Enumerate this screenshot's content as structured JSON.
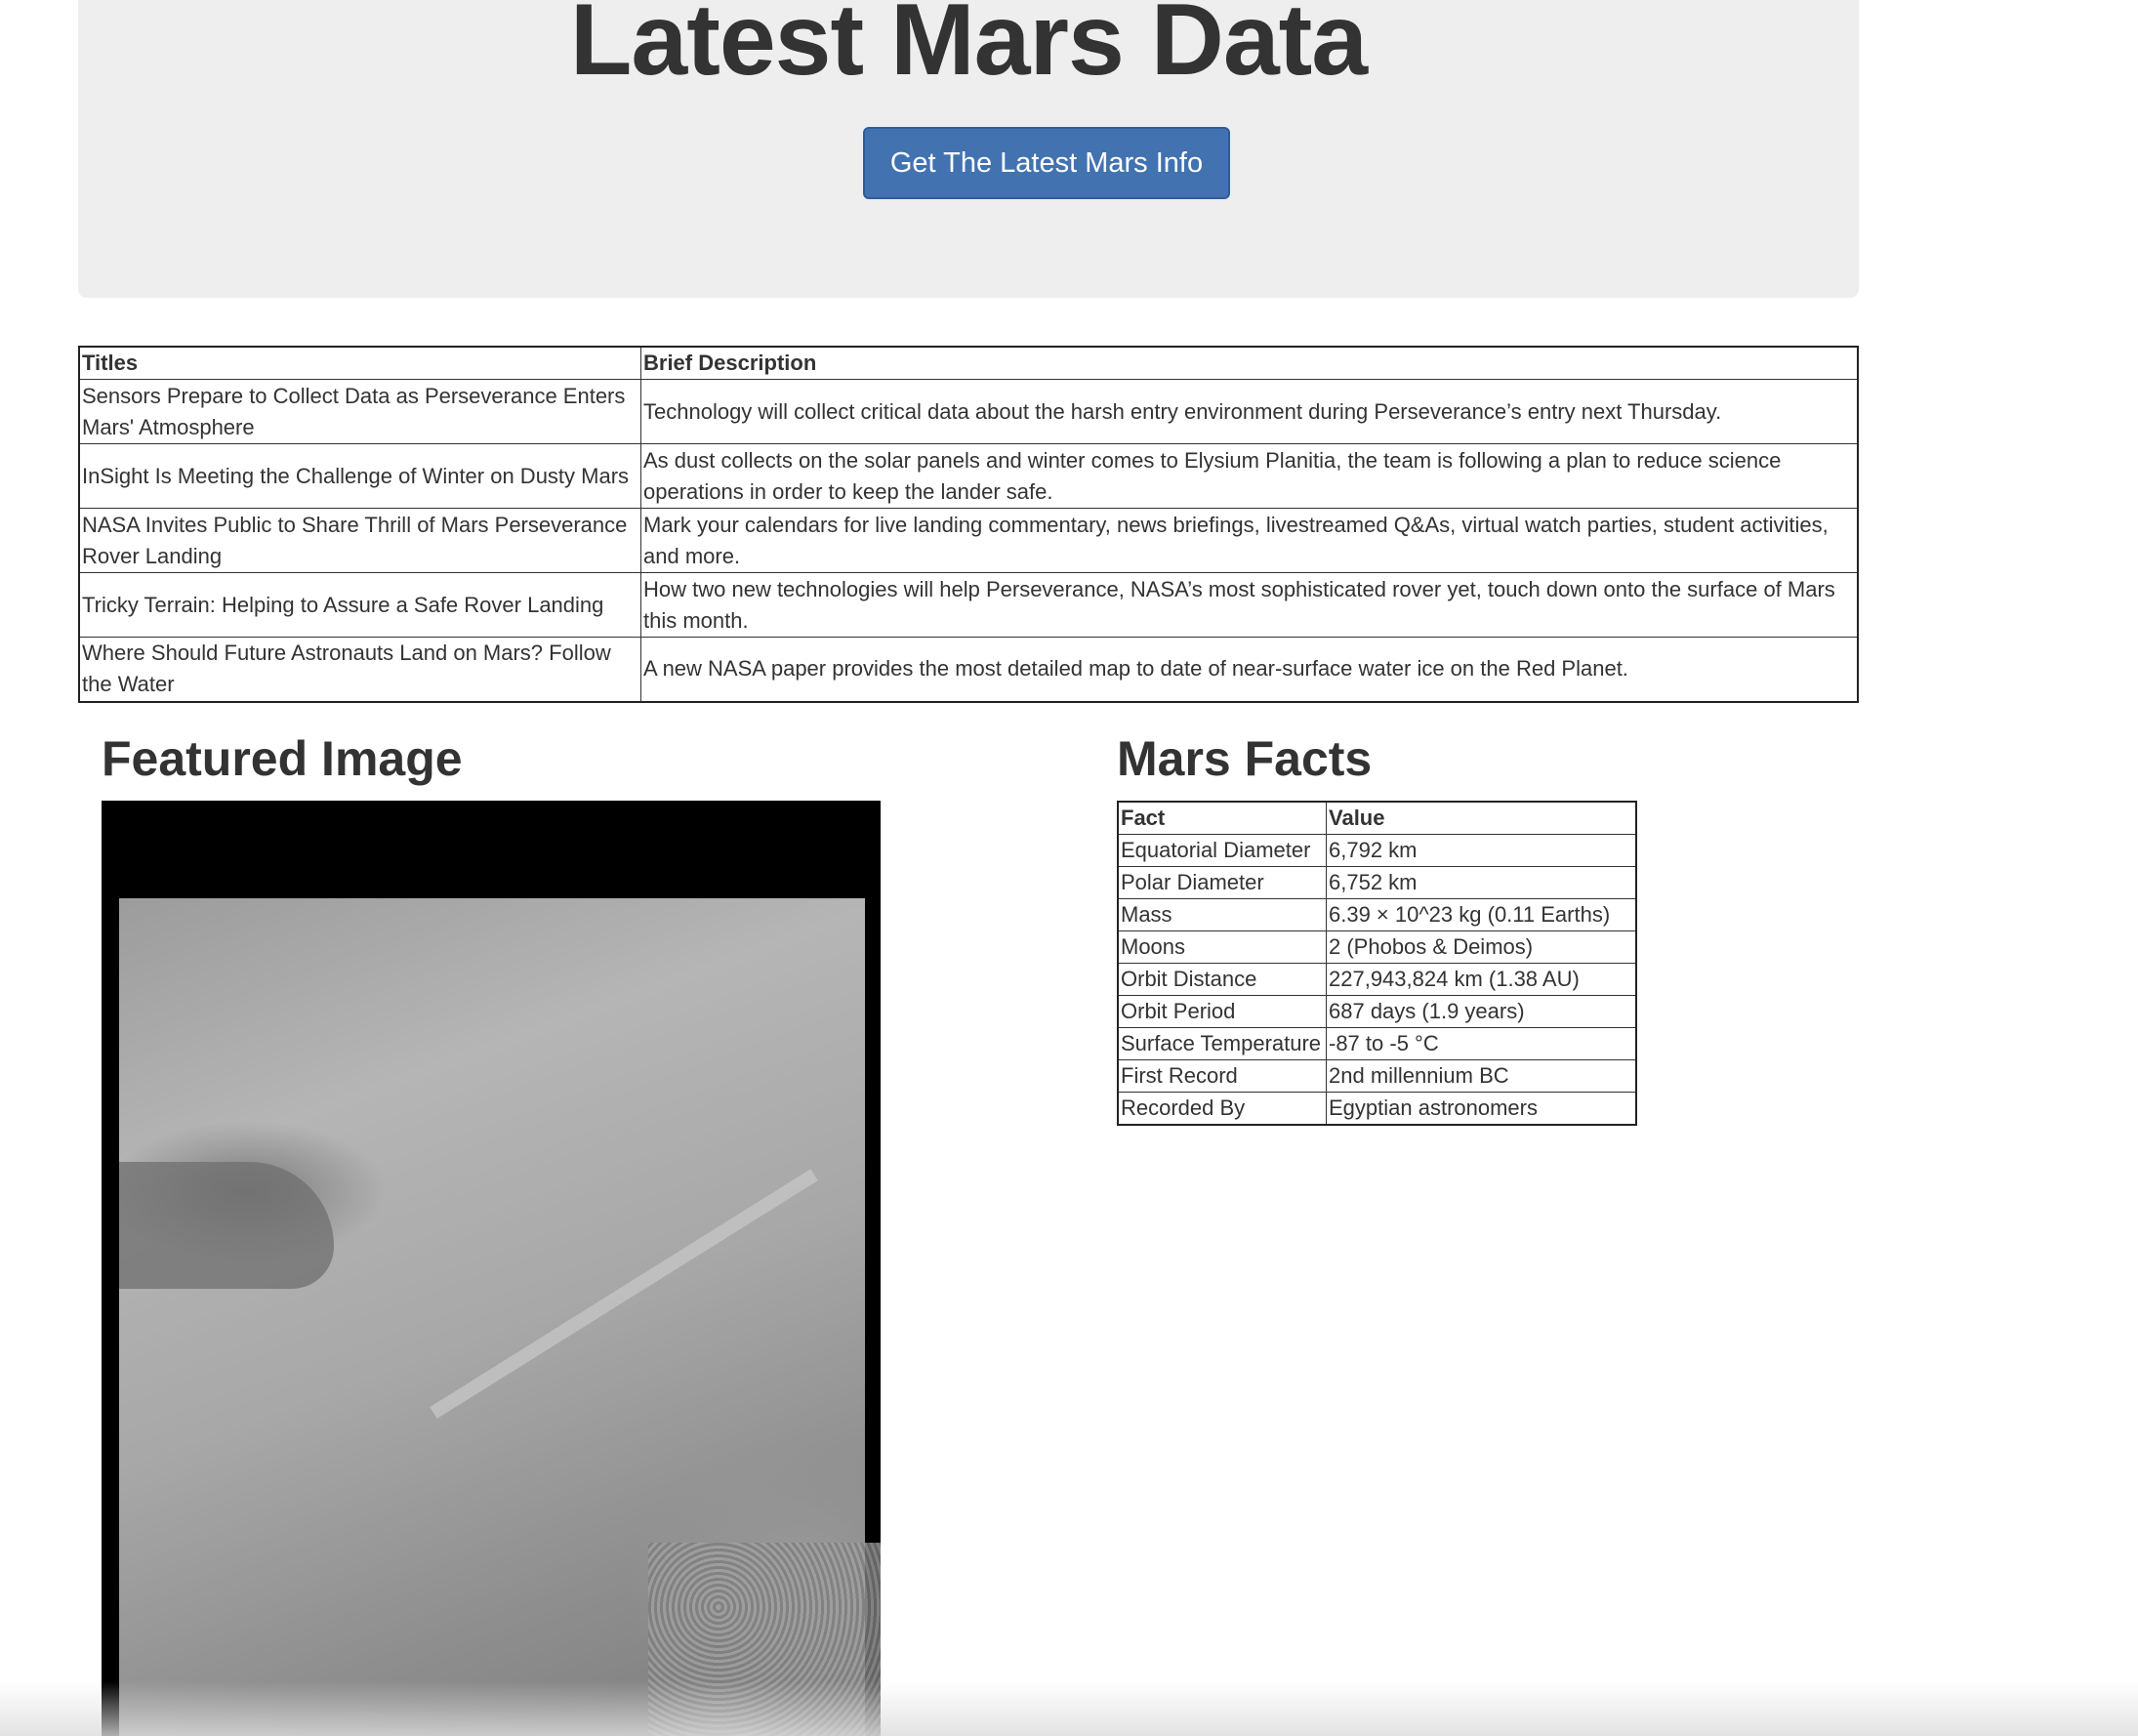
{
  "jumbotron": {
    "title": "Latest Mars Data",
    "button_label": "Get The Latest Mars Info",
    "button_color": "#4272b0"
  },
  "news": {
    "headers": [
      "Titles",
      "Brief Description"
    ],
    "rows": [
      {
        "title": "Sensors Prepare to Collect Data as Perseverance Enters Mars' Atmosphere",
        "description": "Technology will collect critical data about the harsh entry environment during Perseverance’s entry next Thursday."
      },
      {
        "title": "InSight Is Meeting the Challenge of Winter on Dusty Mars",
        "description": "As dust collects on the solar panels and winter comes to Elysium Planitia, the team is following a plan to reduce science operations in order to keep the lander safe."
      },
      {
        "title": "NASA Invites Public to Share Thrill of Mars Perseverance Rover Landing",
        "description": "Mark your calendars for live landing commentary, news briefings, livestreamed Q&As, virtual watch parties, student activities, and more."
      },
      {
        "title": "Tricky Terrain: Helping to Assure a Safe Rover Landing",
        "description": "How two new technologies will help Perseverance, NASA’s most sophisticated rover yet, touch down onto the surface of Mars this month."
      },
      {
        "title": "Where Should Future Astronauts Land on Mars? Follow the Water",
        "description": "A new NASA paper provides the most detailed map to date of near-surface water ice on the Red Planet."
      }
    ]
  },
  "featured": {
    "heading": "Featured Image"
  },
  "facts": {
    "heading": "Mars Facts",
    "headers": [
      "Fact",
      "Value"
    ],
    "rows": [
      {
        "fact": "Equatorial Diameter",
        "value": "6,792 km"
      },
      {
        "fact": "Polar Diameter",
        "value": "6,752 km"
      },
      {
        "fact": "Mass",
        "value": "6.39 × 10^23 kg (0.11 Earths)"
      },
      {
        "fact": "Moons",
        "value": "2 (Phobos & Deimos)"
      },
      {
        "fact": "Orbit Distance",
        "value": "227,943,824 km (1.38 AU)"
      },
      {
        "fact": "Orbit Period",
        "value": "687 days (1.9 years)"
      },
      {
        "fact": "Surface Temperature",
        "value": "-87 to -5 °C"
      },
      {
        "fact": "First Record",
        "value": "2nd millennium BC"
      },
      {
        "fact": "Recorded By",
        "value": "Egyptian astronomers"
      }
    ]
  }
}
